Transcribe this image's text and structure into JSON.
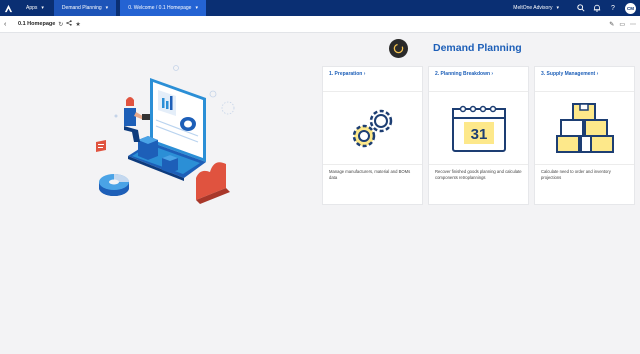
{
  "topnav": {
    "apps_label": "Apps",
    "model_label": "Demand Planning",
    "page_label": "0. Welcome / 0.1 Homepage",
    "workspace_label": "MeltOne Advisory",
    "avatar_initials": "CM"
  },
  "page": {
    "title": "0.1 Homepage"
  },
  "main": {
    "heading": "Demand Planning",
    "cards": [
      {
        "title": "1. Preparation",
        "description": "Manage manufacturers, material and BOMs data",
        "icon": "gears-icon"
      },
      {
        "title": "2. Planning Breakdown",
        "description": "Recover finished goods planning and calculate components retroplannings",
        "icon": "calendar-icon",
        "day": "31"
      },
      {
        "title": "3. Supply Management",
        "description": "Calculate need to order and inventory projections",
        "icon": "boxes-icon"
      }
    ]
  },
  "colors": {
    "nav": "#0a2f73",
    "nav_active": "#2463d3",
    "accent": "#1d5fb8",
    "yellow": "#fde88a"
  }
}
